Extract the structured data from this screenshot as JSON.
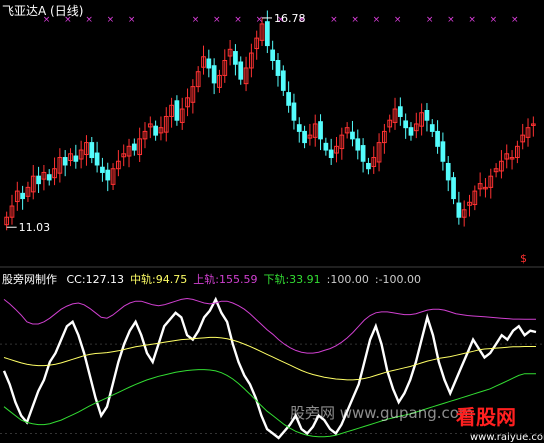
{
  "upper_panel": {
    "title": "飞亚达A (日线)",
    "marker_symbol": "×",
    "high_label": "16.78",
    "low_label": "11.03",
    "dollar_badge": "$"
  },
  "lower_panel": {
    "indicator_name": "股旁网制作",
    "values": [
      {
        "key": "cc",
        "text": "CC:127.13",
        "color": "#ffffff"
      },
      {
        "key": "mid",
        "text": "中轨:94.75",
        "color": "#ffff66"
      },
      {
        "key": "upper",
        "text": "上轨:155.59",
        "color": "#d040d0"
      },
      {
        "key": "lower",
        "text": "下轨:33.91",
        "color": "#33dd33"
      },
      {
        "key": "p100",
        "text": ":100.00",
        "color": "#cccccc"
      },
      {
        "key": "m100",
        "text": ":-100.00",
        "color": "#cccccc"
      }
    ],
    "watermark": "股旁网 www.gupang.com",
    "logo_text": "看股网",
    "logo_url": "www.raiyue.com"
  },
  "chart_data": [
    {
      "type": "candlestick",
      "title": "飞亚达A (日线)",
      "colors": {
        "up": "#ff3232",
        "down": "#54fcfc"
      },
      "y_high_marked": 16.78,
      "y_low_marked": 11.03,
      "ylim": [
        10.4,
        17.1
      ],
      "close_series": [
        11.6,
        11.9,
        12.3,
        12.1,
        12.4,
        12.7,
        12.5,
        12.8,
        12.6,
        12.9,
        13.2,
        13.0,
        13.3,
        13.1,
        13.4,
        13.6,
        13.2,
        13.0,
        12.8,
        12.6,
        12.9,
        13.1,
        13.3,
        13.5,
        13.4,
        13.7,
        13.9,
        14.1,
        13.8,
        14.0,
        14.3,
        14.6,
        14.2,
        14.5,
        14.8,
        15.1,
        15.5,
        15.9,
        15.6,
        15.2,
        15.4,
        15.8,
        16.1,
        15.7,
        15.3,
        15.6,
        16.0,
        16.4,
        16.78,
        16.2,
        15.8,
        15.4,
        15.0,
        14.6,
        14.2,
        13.9,
        13.6,
        13.8,
        14.1,
        13.7,
        13.4,
        13.2,
        13.5,
        13.8,
        14.0,
        13.7,
        13.4,
        13.1,
        12.9,
        13.2,
        13.6,
        13.9,
        14.2,
        14.5,
        14.3,
        14.0,
        13.8,
        14.1,
        14.4,
        14.2,
        13.9,
        13.5,
        13.1,
        12.6,
        12.1,
        11.6,
        11.8,
        12.0,
        12.3,
        12.5,
        12.4,
        12.7,
        12.9,
        13.1,
        13.3,
        13.2,
        13.5,
        13.8,
        14.0,
        14.1
      ]
    },
    {
      "type": "line",
      "title": "股旁网制作",
      "ylim": [
        -110,
        230
      ],
      "reference_lines": [
        100,
        -100
      ],
      "series": [
        {
          "name": "CC",
          "color": "#ffffff",
          "values": [
            40,
            10,
            -30,
            -60,
            -75,
            -40,
            -5,
            20,
            60,
            80,
            110,
            140,
            150,
            120,
            80,
            30,
            -20,
            -60,
            -40,
            10,
            60,
            100,
            130,
            150,
            120,
            80,
            60,
            100,
            140,
            155,
            170,
            160,
            120,
            110,
            130,
            160,
            175,
            200,
            170,
            150,
            100,
            60,
            30,
            10,
            -20,
            -60,
            -90,
            -100,
            -110,
            -95,
            -80,
            -60,
            -90,
            -100,
            -85,
            -60,
            -70,
            -90,
            -100,
            -80,
            -50,
            -20,
            10,
            60,
            110,
            140,
            100,
            40,
            0,
            -30,
            -10,
            20,
            60,
            110,
            160,
            120,
            60,
            20,
            -10,
            20,
            50,
            80,
            110,
            90,
            70,
            80,
            100,
            120,
            110,
            130,
            140,
            120,
            130,
            127.13
          ]
        },
        {
          "name": "中轨",
          "color": "#ffff66",
          "values": [
            70,
            66,
            62,
            58,
            55,
            53,
            52,
            52,
            53,
            55,
            58,
            62,
            66,
            70,
            74,
            77,
            79,
            80,
            81,
            83,
            85,
            88,
            91,
            94,
            96,
            98,
            100,
            102,
            104,
            106,
            108,
            110,
            111,
            112,
            113,
            114,
            115,
            115,
            114,
            112,
            109,
            105,
            100,
            95,
            89,
            83,
            77,
            71,
            65,
            59,
            53,
            47,
            41,
            36,
            32,
            29,
            26,
            24,
            22,
            21,
            20,
            20,
            21,
            23,
            26,
            30,
            34,
            38,
            41,
            44,
            47,
            50,
            54,
            58,
            62,
            65,
            68,
            70,
            72,
            75,
            78,
            81,
            84,
            87,
            89,
            90,
            91,
            92,
            93,
            94,
            94,
            94.75,
            94.75,
            94.75
          ]
        },
        {
          "name": "上轨",
          "color": "#d040d0",
          "values": [
            200,
            190,
            178,
            165,
            150,
            145,
            145,
            150,
            158,
            168,
            178,
            185,
            190,
            192,
            188,
            180,
            170,
            160,
            158,
            165,
            175,
            185,
            192,
            196,
            196,
            192,
            188,
            186,
            188,
            192,
            196,
            200,
            202,
            200,
            196,
            192,
            190,
            192,
            196,
            196,
            192,
            186,
            178,
            168,
            156,
            144,
            132,
            122,
            110,
            100,
            92,
            86,
            82,
            80,
            80,
            82,
            86,
            90,
            96,
            104,
            114,
            126,
            140,
            154,
            164,
            170,
            172,
            172,
            170,
            168,
            166,
            166,
            168,
            172,
            176,
            178,
            178,
            176,
            172,
            168,
            166,
            164,
            163,
            162,
            161,
            160,
            159,
            158,
            157,
            156,
            156,
            155.59,
            155.59,
            155.59
          ]
        },
        {
          "name": "下轨",
          "color": "#33dd33",
          "values": [
            -40,
            -50,
            -60,
            -70,
            -75,
            -78,
            -80,
            -80,
            -78,
            -74,
            -70,
            -64,
            -58,
            -52,
            -45,
            -38,
            -32,
            -26,
            -20,
            -14,
            -8,
            -2,
            4,
            10,
            15,
            20,
            24,
            28,
            31,
            34,
            37,
            39,
            41,
            42,
            43,
            43,
            42,
            40,
            36,
            30,
            22,
            12,
            0,
            -12,
            -25,
            -38,
            -50,
            -60,
            -70,
            -80,
            -88,
            -95,
            -100,
            -104,
            -106,
            -107,
            -107,
            -106,
            -104,
            -100,
            -96,
            -92,
            -88,
            -84,
            -80,
            -76,
            -72,
            -68,
            -65,
            -62,
            -59,
            -56,
            -52,
            -48,
            -44,
            -40,
            -36,
            -32,
            -28,
            -24,
            -20,
            -16,
            -12,
            -8,
            -4,
            0,
            6,
            12,
            18,
            24,
            30,
            33.91,
            33.91,
            33.91
          ]
        }
      ]
    }
  ]
}
